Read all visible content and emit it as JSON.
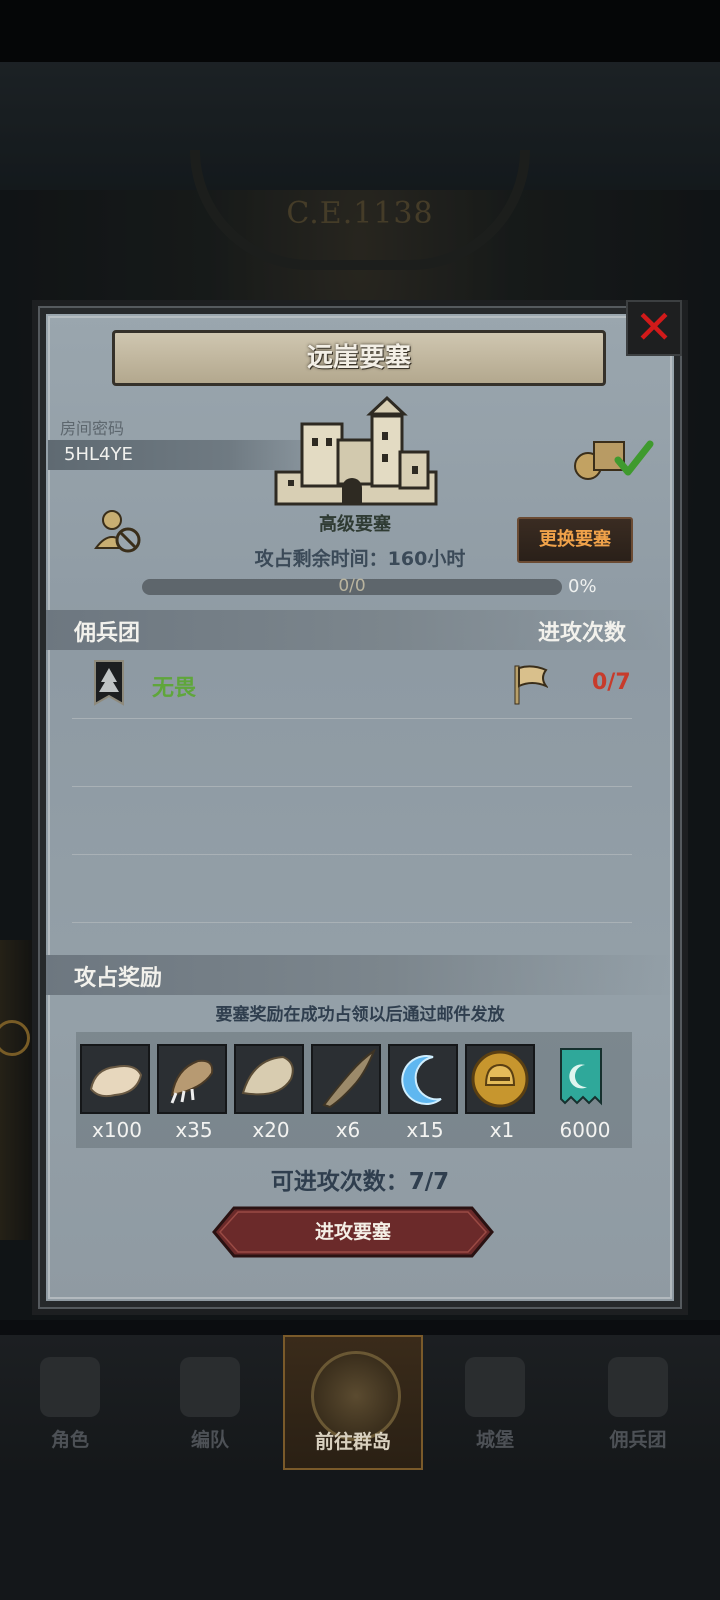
{
  "background": {
    "era_text": "C.E.1138"
  },
  "dialog": {
    "title": "远崖要塞",
    "room_label": "房间密码",
    "room_code": "5HL4YE",
    "fortress_type": "高级要塞",
    "change_button": "更换要塞",
    "time_left_label": "攻占剩余时间：",
    "time_left_value": "160小时",
    "progress_text": "0/0",
    "progress_value": 0,
    "progress_percent": "0%",
    "mercenary_header": "佣兵团",
    "attack_count_header": "进攻次数",
    "mercenaries": [
      {
        "name": "无畏",
        "attacks": "0/7"
      }
    ],
    "rewards_header": "攻占奖励",
    "rewards_note": "要塞奖励在成功占领以后通过邮件发放",
    "rewards": [
      {
        "icon": "white-fur-icon",
        "qty": "x100"
      },
      {
        "icon": "beast-claw-icon",
        "qty": "x35"
      },
      {
        "icon": "pale-hide-icon",
        "qty": "x20"
      },
      {
        "icon": "twisted-horn-icon",
        "qty": "x6"
      },
      {
        "icon": "blue-crescent-icon",
        "qty": "x15"
      },
      {
        "icon": "golden-helmet-medal-icon",
        "qty": "x1"
      },
      {
        "icon": "teal-banner-icon",
        "qty": "6000"
      }
    ],
    "attacks_left": "可进攻次数：7/7",
    "attack_button": "进攻要塞"
  },
  "bottom_nav": [
    {
      "label": "角色",
      "icon": "character-icon",
      "active": false
    },
    {
      "label": "编队",
      "icon": "formation-icon",
      "active": false
    },
    {
      "label": "前往群岛",
      "icon": "islands-icon",
      "active": true
    },
    {
      "label": "城堡",
      "icon": "castle-icon",
      "active": false
    },
    {
      "label": "佣兵团",
      "icon": "mercenary-icon",
      "active": false
    }
  ],
  "colors": {
    "panel": "#929ea6",
    "change_button_text": "#f0a24a",
    "merc_name": "#5fa63b",
    "attack_count": "#c73b2b",
    "close_x": "#d11a1a",
    "attack_button": "#6b2a2a"
  }
}
